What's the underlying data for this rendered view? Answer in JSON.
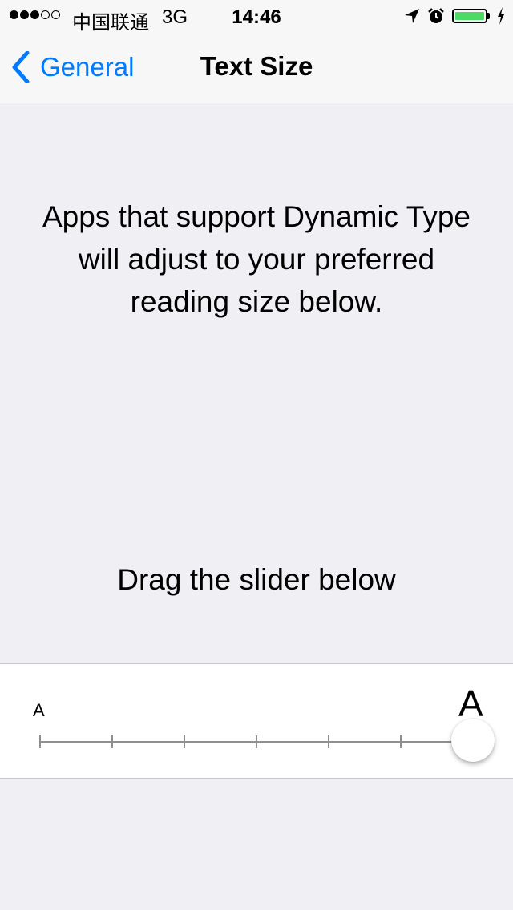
{
  "status_bar": {
    "signal_bars": 5,
    "signal_filled": 3,
    "carrier": "中国联通",
    "network": "3G",
    "time": "14:46",
    "icons": [
      "location-arrow-icon",
      "alarm-clock-icon",
      "battery-icon",
      "charging-bolt-icon"
    ],
    "battery_level": 1.0
  },
  "nav": {
    "back_label": "General",
    "title": "Text Size"
  },
  "content": {
    "intro": "Apps that support Dynamic Type will adjust to your preferred reading size below.",
    "instruction": "Drag the slider below"
  },
  "slider": {
    "min_label": "A",
    "max_label": "A",
    "steps": 7,
    "selected_step": 7
  },
  "colors": {
    "accent": "#007aff",
    "background": "#efeff4",
    "battery": "#4cd964"
  }
}
